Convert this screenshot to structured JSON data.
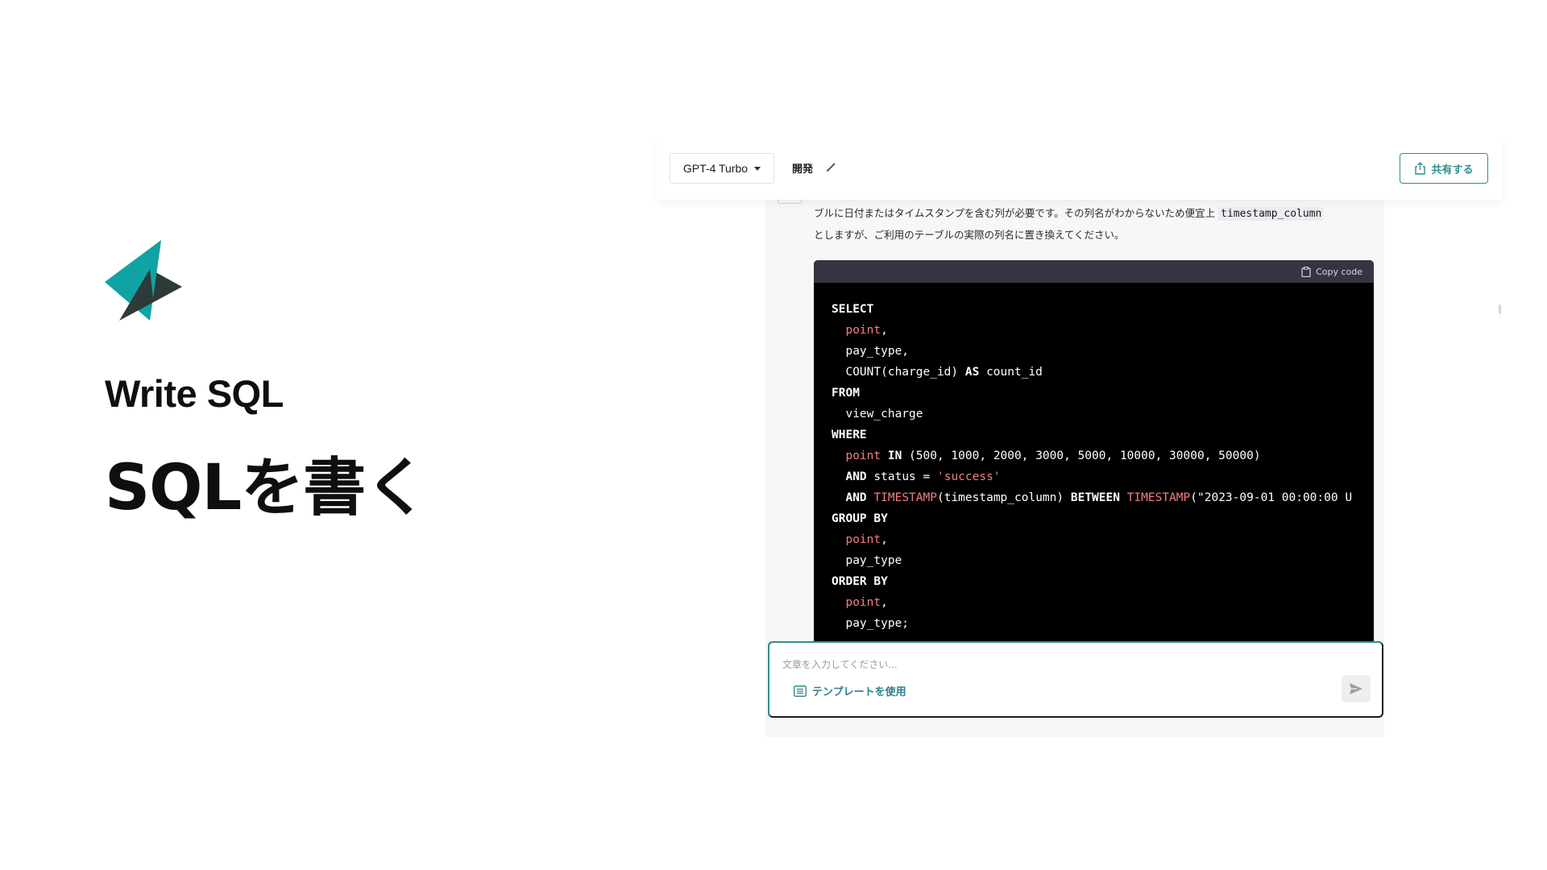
{
  "hero": {
    "title_en": "Write SQL",
    "title_ja": "SQLを書く",
    "logo_colors": {
      "teal": "#10a3a3",
      "dark": "#2c3a38"
    }
  },
  "header": {
    "model_label": "GPT-4 Turbo",
    "chat_name": "開発",
    "share_label": "共有する"
  },
  "answer": {
    "text_part1": "ブルに日付またはタイムスタンプを含む列が必要です。その列名がわからないため便宜上",
    "inline_code": "timestamp_column",
    "text_part2": "としますが、ご利用のテーブルの実際の列名に置き換えてください。"
  },
  "code_block": {
    "copy_label": "Copy code",
    "lines": [
      [
        {
          "t": "SELECT",
          "c": "kw"
        }
      ],
      [
        {
          "t": "  "
        },
        {
          "t": "point",
          "c": "fn"
        },
        {
          "t": ","
        }
      ],
      [
        {
          "t": "  pay_type,"
        }
      ],
      [
        {
          "t": "  COUNT(charge_id) "
        },
        {
          "t": "AS",
          "c": "kw"
        },
        {
          "t": " count_id"
        }
      ],
      [
        {
          "t": "FROM",
          "c": "kw"
        }
      ],
      [
        {
          "t": "  view_charge"
        }
      ],
      [
        {
          "t": "WHERE",
          "c": "kw"
        }
      ],
      [
        {
          "t": "  "
        },
        {
          "t": "point",
          "c": "fn"
        },
        {
          "t": " "
        },
        {
          "t": "IN",
          "c": "kw"
        },
        {
          "t": " (500, 1000, 2000, 3000, 5000, 10000, 30000, 50000)"
        }
      ],
      [
        {
          "t": "  "
        },
        {
          "t": "AND",
          "c": "kw"
        },
        {
          "t": " status = "
        },
        {
          "t": "'success'",
          "c": "str"
        }
      ],
      [
        {
          "t": "  "
        },
        {
          "t": "AND",
          "c": "kw"
        },
        {
          "t": " "
        },
        {
          "t": "TIMESTAMP",
          "c": "fn"
        },
        {
          "t": "(timestamp_column) "
        },
        {
          "t": "BETWEEN",
          "c": "kw"
        },
        {
          "t": " "
        },
        {
          "t": "TIMESTAMP",
          "c": "fn"
        },
        {
          "t": "(\"2023-09-01 00:00:00 U"
        }
      ],
      [
        {
          "t": "GROUP BY",
          "c": "kw"
        }
      ],
      [
        {
          "t": "  "
        },
        {
          "t": "point",
          "c": "fn"
        },
        {
          "t": ","
        }
      ],
      [
        {
          "t": "  pay_type"
        }
      ],
      [
        {
          "t": "ORDER BY",
          "c": "kw"
        }
      ],
      [
        {
          "t": "  "
        },
        {
          "t": "point",
          "c": "fn"
        },
        {
          "t": ","
        }
      ],
      [
        {
          "t": "  pay_type;"
        }
      ]
    ]
  },
  "composer": {
    "placeholder": "文章を入力してください...",
    "template_label": "テンプレートを使用"
  }
}
